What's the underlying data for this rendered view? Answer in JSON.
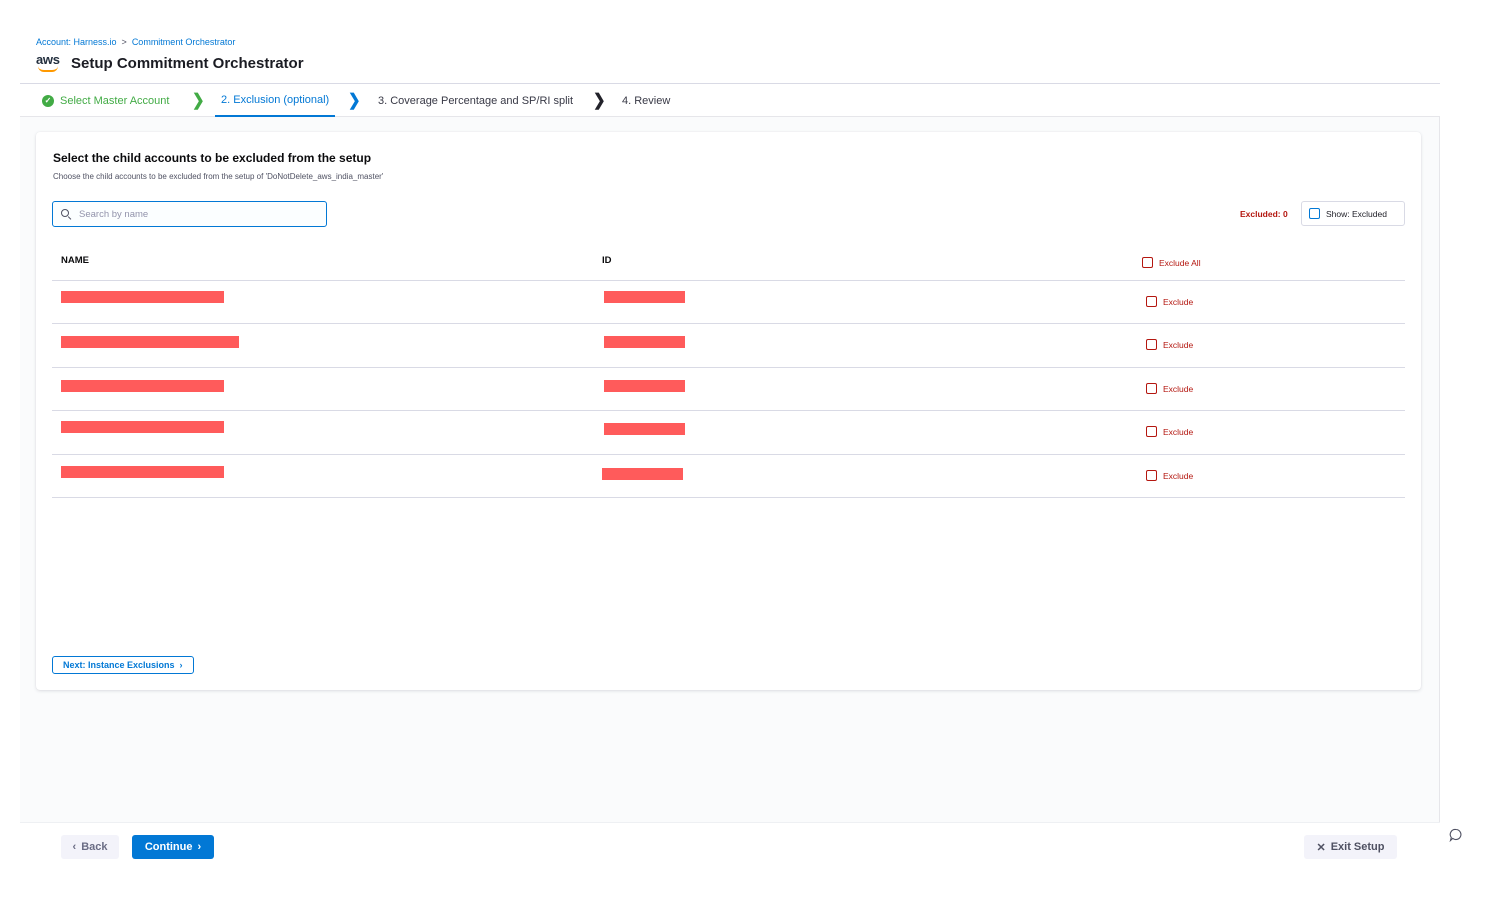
{
  "breadcrumb": {
    "account": "Account: Harness.io",
    "separator": ">",
    "module": "Commitment Orchestrator"
  },
  "header": {
    "logo_text": "aws",
    "title": "Setup Commitment Orchestrator"
  },
  "steps": [
    {
      "label": "Select Master Account",
      "state": "done"
    },
    {
      "label": "2. Exclusion (optional)",
      "state": "active"
    },
    {
      "label": "3. Coverage Percentage and SP/RI split",
      "state": "todo"
    },
    {
      "label": "4. Review",
      "state": "todo"
    }
  ],
  "step_chevron": "❯",
  "card": {
    "title": "Select the child accounts to be excluded from the setup",
    "subtitle": "Choose the child accounts to be excluded from the setup of 'DoNotDelete_aws_india_master'",
    "search_placeholder": "Search by name",
    "excluded_count": "Excluded: 0",
    "show_excluded_label": "Show: Excluded"
  },
  "table": {
    "columns": {
      "name": "NAME",
      "id": "ID"
    },
    "exclude_all_label": "Exclude All",
    "rows": [
      {
        "exclude_label": "Exclude",
        "checked": false
      },
      {
        "exclude_label": "Exclude",
        "checked": false
      },
      {
        "exclude_label": "Exclude",
        "checked": false
      },
      {
        "exclude_label": "Exclude",
        "checked": false
      },
      {
        "exclude_label": "Exclude",
        "checked": false
      }
    ]
  },
  "next_button": {
    "label": "Next: Instance Exclusions",
    "icon": "chevron-right-icon"
  },
  "footer": {
    "back_label": "Back",
    "continue_label": "Continue",
    "exit_label": "Exit Setup"
  },
  "colors": {
    "primary": "#0278d5",
    "success": "#42ab45",
    "danger": "#b41710",
    "redaction": "#ff5b5b",
    "aws_orange": "#ff9900"
  }
}
